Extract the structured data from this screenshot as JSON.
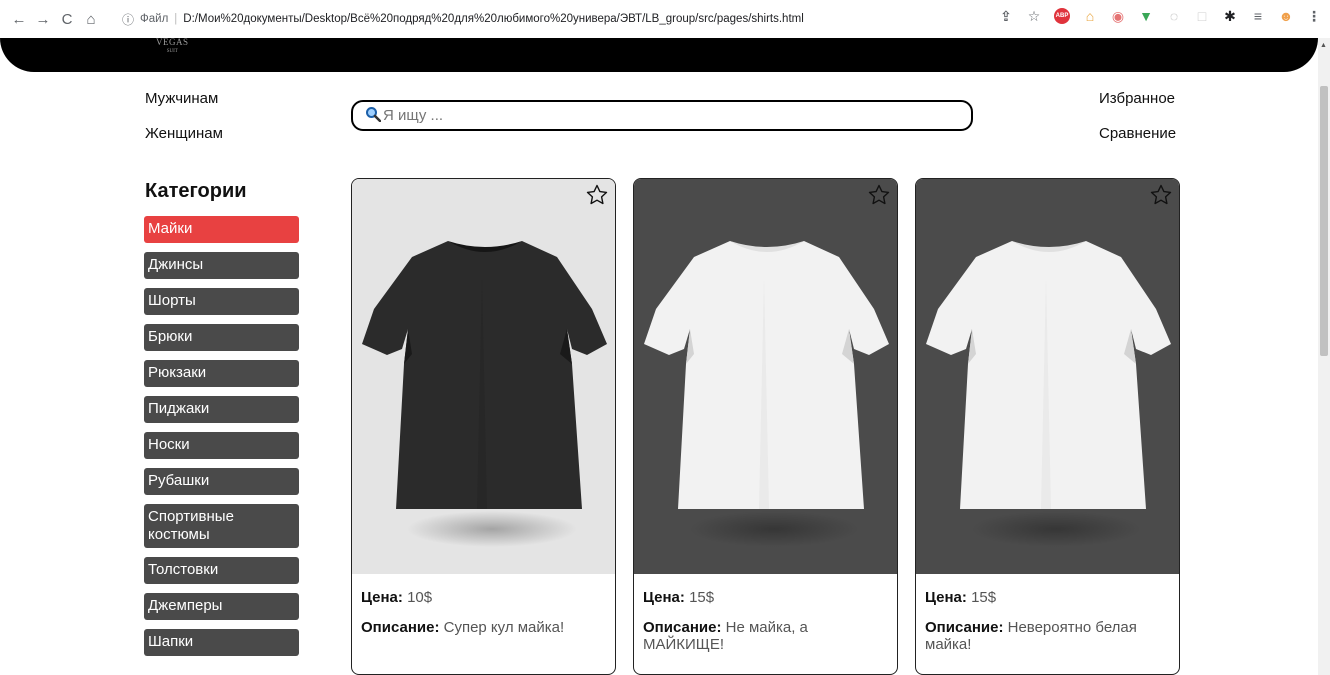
{
  "browser": {
    "info_label": "ⓘ",
    "file_label": "Файл",
    "url": "D:/Мои%20документы/Desktop/Всё%20подряд%20для%20любимого%20универа/ЭВТ/LB_group/src/pages/shirts.html",
    "extensions": [
      {
        "name": "share-icon",
        "glyph": "⇪",
        "color": "#5f6368"
      },
      {
        "name": "bookmark-star-icon",
        "glyph": "☆",
        "color": "#5f6368"
      },
      {
        "name": "adblock-icon",
        "glyph": "ABP",
        "color": "#e0333c"
      },
      {
        "name": "extension-icon",
        "glyph": "⌂",
        "color": "#e8a33a"
      },
      {
        "name": "extension-icon",
        "glyph": "◉",
        "color": "#e57373"
      },
      {
        "name": "shield-icon",
        "glyph": "▼",
        "color": "#3aa757"
      },
      {
        "name": "extension-icon",
        "glyph": "◌",
        "color": "#9e9e9e"
      },
      {
        "name": "extension-icon",
        "glyph": "□",
        "color": "#cfcfcf"
      },
      {
        "name": "puzzle-icon",
        "glyph": "✱",
        "color": "#202124"
      },
      {
        "name": "reading-list-icon",
        "glyph": "≡",
        "color": "#5f6368"
      },
      {
        "name": "profile-avatar-icon",
        "glyph": "☻",
        "color": "#f0a04b"
      },
      {
        "name": "menu-icon",
        "glyph": "⋮",
        "color": "#5f6368"
      }
    ]
  },
  "header": {
    "logo_line1": "VEGAS",
    "logo_line2": "SUIT",
    "links": {
      "men": "Мужчинам",
      "women": "Женщинам",
      "favorites": "Избранное",
      "compare": "Сравнение"
    },
    "search_placeholder": "Я ищу ..."
  },
  "categories": {
    "title": "Категории",
    "items": [
      {
        "label": "Майки",
        "active": true
      },
      {
        "label": "Джинсы",
        "active": false
      },
      {
        "label": "Шорты",
        "active": false
      },
      {
        "label": "Брюки",
        "active": false
      },
      {
        "label": "Рюкзаки",
        "active": false
      },
      {
        "label": "Пиджаки",
        "active": false
      },
      {
        "label": "Носки",
        "active": false
      },
      {
        "label": "Рубашки",
        "active": false
      },
      {
        "label": "Спортивные костюмы",
        "active": false
      },
      {
        "label": "Толстовки",
        "active": false
      },
      {
        "label": "Джемперы",
        "active": false
      },
      {
        "label": "Шапки",
        "active": false
      }
    ]
  },
  "products": [
    {
      "price_label": "Цена:",
      "price": "10$",
      "desc_label": "Описание:",
      "desc": "Супер кул майка!",
      "shirt_color": "black",
      "bg": "light"
    },
    {
      "price_label": "Цена:",
      "price": "15$",
      "desc_label": "Описание:",
      "desc": "Не майка, а МАЙКИЩЕ!",
      "shirt_color": "white",
      "bg": "dark"
    },
    {
      "price_label": "Цена:",
      "price": "15$",
      "desc_label": "Описание:",
      "desc": "Невероятно белая майка!",
      "shirt_color": "white",
      "bg": "dark"
    }
  ],
  "colors": {
    "active_category": "#e84141",
    "category": "#4a4a4a",
    "header_bg": "#000000"
  }
}
